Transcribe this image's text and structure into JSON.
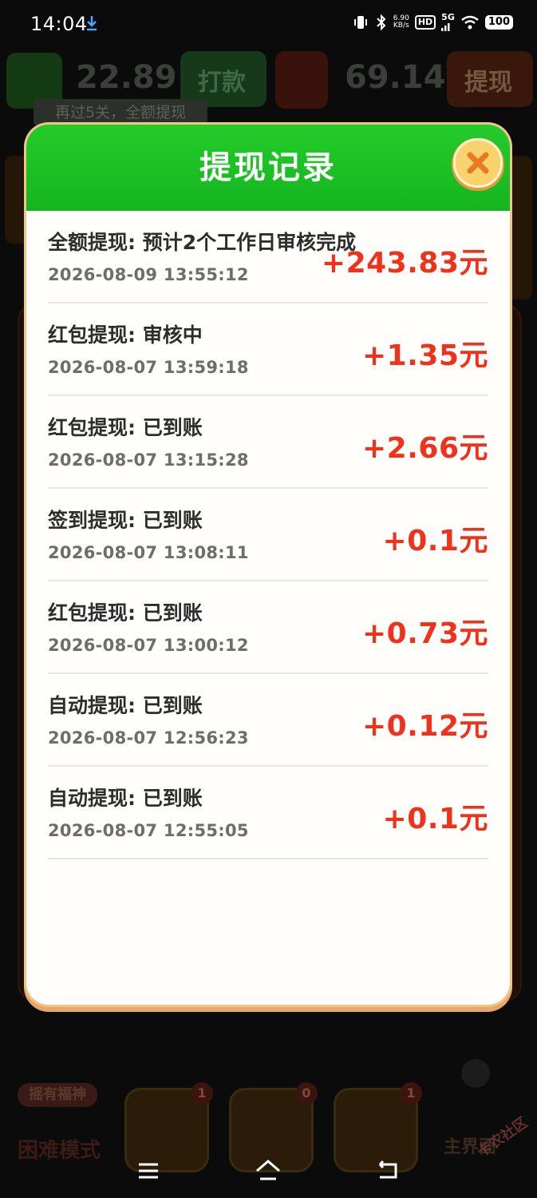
{
  "status_bar": {
    "time": "14:04",
    "net_speed_value": "6.90",
    "net_speed_unit": "KB/s",
    "hd_label": "HD",
    "network_label": "5G",
    "battery": "100"
  },
  "background": {
    "balance_left": "22.89",
    "button_left": "打款",
    "balance_right": "69.14",
    "button_right": "提现",
    "hint": "再过5关，全额提现",
    "mode_tag": "摇有福神",
    "mode_label": "困难模式",
    "tool_badges": [
      "1",
      "0",
      "1"
    ],
    "main_menu": "主界面"
  },
  "watermark": "卡农社区",
  "modal": {
    "title": "提现记录",
    "records": [
      {
        "title": "全额提现: 预计2个工作日审核完成",
        "time": "2026-08-09 13:55:12",
        "amount": "+243.83元"
      },
      {
        "title": "红包提现: 审核中",
        "time": "2026-08-07 13:59:18",
        "amount": "+1.35元"
      },
      {
        "title": "红包提现: 已到账",
        "time": "2026-08-07 13:15:28",
        "amount": "+2.66元"
      },
      {
        "title": "签到提现: 已到账",
        "time": "2026-08-07 13:08:11",
        "amount": "+0.1元"
      },
      {
        "title": "红包提现: 已到账",
        "time": "2026-08-07 13:00:12",
        "amount": "+0.73元"
      },
      {
        "title": "自动提现: 已到账",
        "time": "2026-08-07 12:56:23",
        "amount": "+0.12元"
      },
      {
        "title": "自动提现: 已到账",
        "time": "2026-08-07 12:55:05",
        "amount": "+0.1元"
      }
    ]
  },
  "icons": {
    "close": "close-icon",
    "download": "download-icon",
    "nav_menu": "menu-icon",
    "nav_home": "home-icon",
    "nav_back": "back-icon"
  }
}
